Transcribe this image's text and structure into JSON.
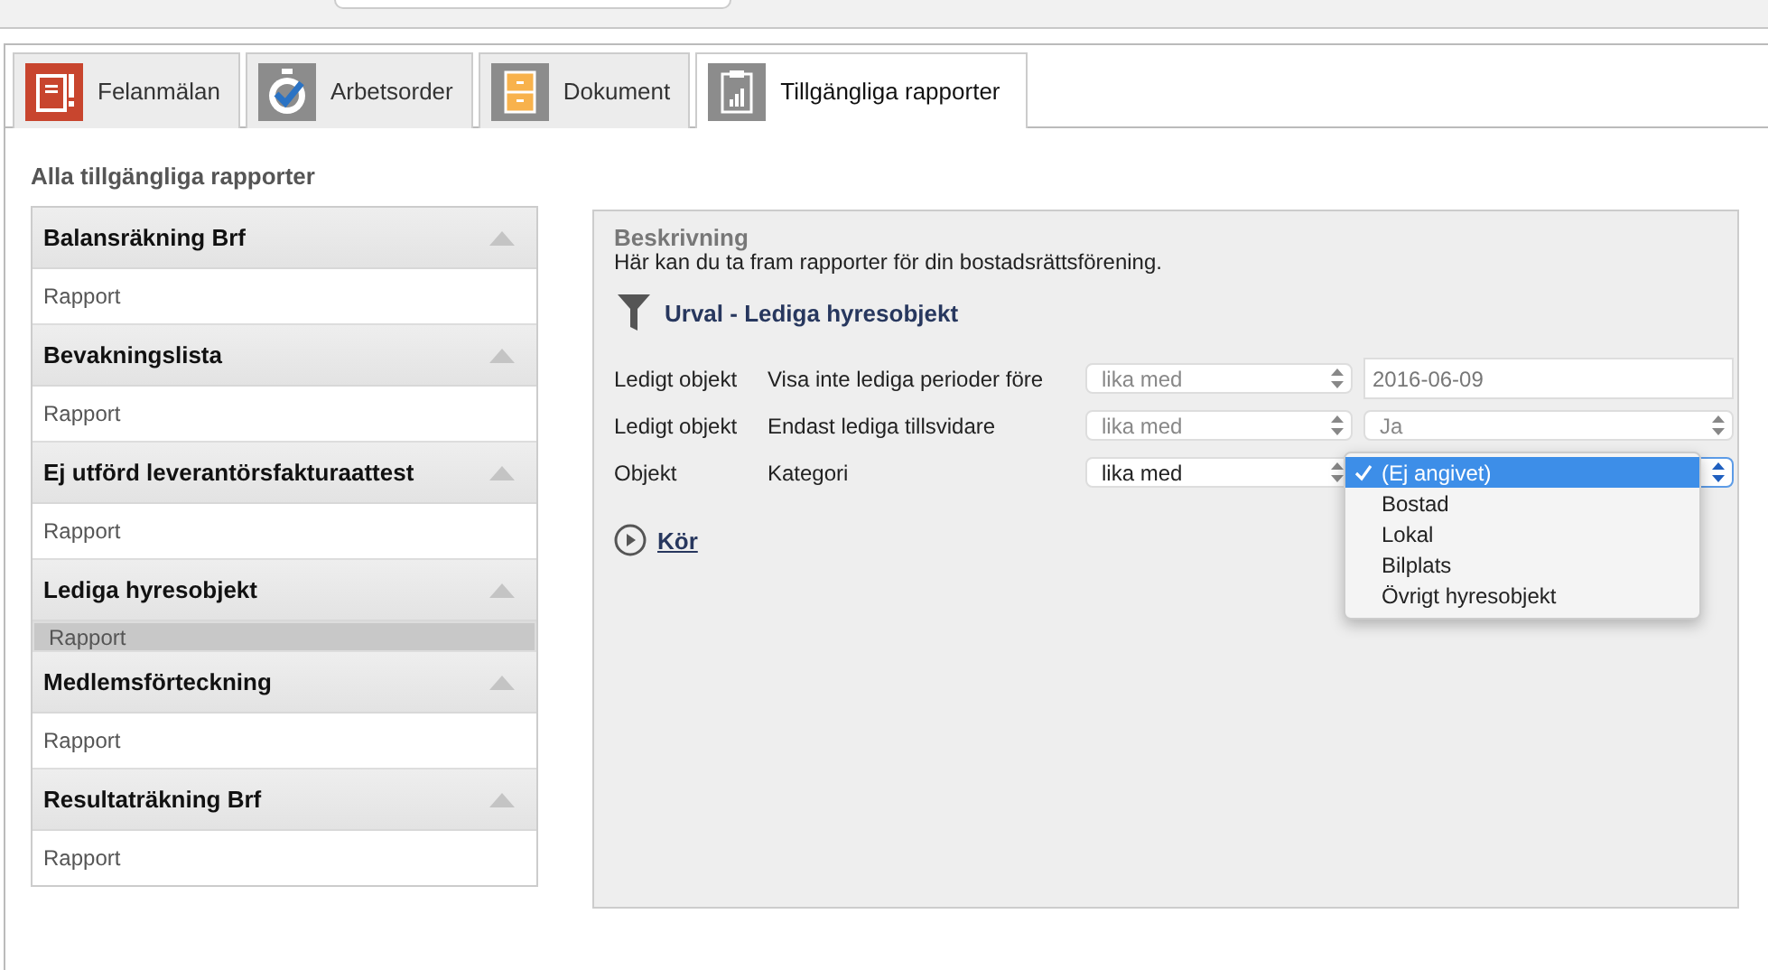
{
  "tabs": [
    {
      "label": "Felanmälan",
      "kind": "alert",
      "selected": false
    },
    {
      "label": "Arbetsorder",
      "kind": "timer",
      "selected": false
    },
    {
      "label": "Dokument",
      "kind": "cabinet",
      "selected": false
    },
    {
      "label": "Tillgängliga rapporter",
      "kind": "report",
      "selected": true
    }
  ],
  "sidebar": {
    "title": "Alla tillgängliga rapporter",
    "groups": [
      {
        "title": "Balansräkning Brf",
        "items": [
          {
            "label": "Rapport",
            "selected": false
          }
        ]
      },
      {
        "title": "Bevakningslista",
        "items": [
          {
            "label": "Rapport",
            "selected": false
          }
        ]
      },
      {
        "title": "Ej utförd leverantörsfakturaattest",
        "items": [
          {
            "label": "Rapport",
            "selected": false
          }
        ]
      },
      {
        "title": "Lediga hyresobjekt",
        "items": [
          {
            "label": "Rapport",
            "selected": true
          }
        ]
      },
      {
        "title": "Medlemsförteckning",
        "items": [
          {
            "label": "Rapport",
            "selected": false
          }
        ]
      },
      {
        "title": "Resultaträkning Brf",
        "items": [
          {
            "label": "Rapport",
            "selected": false
          }
        ]
      }
    ]
  },
  "panel": {
    "heading": "Beskrivning",
    "description": "Här kan du ta fram rapporter för din bostadsrättsförening.",
    "filter_title": "Urval - Lediga hyresobjekt",
    "rows": [
      {
        "field": "Ledigt objekt",
        "criterion": "Visa inte lediga perioder före",
        "operator": "lika med",
        "disabled": true,
        "kind": "text",
        "value": "2016-06-09"
      },
      {
        "field": "Ledigt objekt",
        "criterion": "Endast lediga tillsvidare",
        "operator": "lika med",
        "disabled": true,
        "kind": "select",
        "value": "Ja",
        "expanded": false
      },
      {
        "field": "Objekt",
        "criterion": "Kategori",
        "operator": "lika med",
        "disabled": false,
        "kind": "select",
        "expanded": true,
        "options": [
          {
            "label": "(Ej angivet)",
            "selected": true
          },
          {
            "label": "Bostad",
            "selected": false
          },
          {
            "label": "Lokal",
            "selected": false
          },
          {
            "label": "Bilplats",
            "selected": false
          },
          {
            "label": "Övrigt hyresobjekt",
            "selected": false
          }
        ]
      }
    ],
    "run_label": "Kör"
  }
}
